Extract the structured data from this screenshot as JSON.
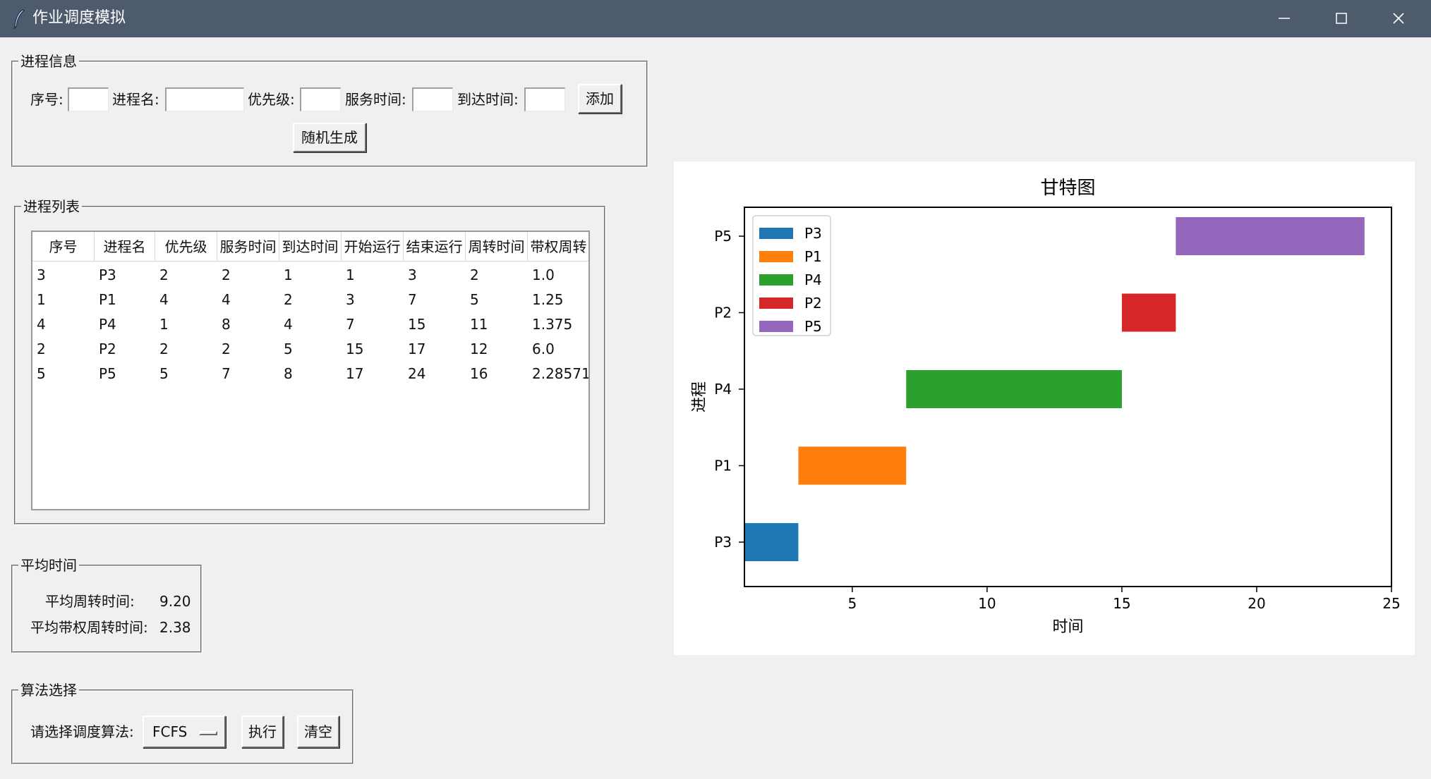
{
  "window": {
    "title": "作业调度模拟"
  },
  "process_info": {
    "group_title": "进程信息",
    "id_label": "序号:",
    "name_label": "进程名:",
    "priority_label": "优先级:",
    "service_label": "服务时间:",
    "arrival_label": "到达时间:",
    "id_value": "",
    "name_value": "",
    "priority_value": "",
    "service_value": "",
    "arrival_value": "",
    "add_button": "添加",
    "random_button": "随机生成"
  },
  "process_list": {
    "group_title": "进程列表",
    "columns": [
      "序号",
      "进程名",
      "优先级",
      "服务时间",
      "到达时间",
      "开始运行",
      "结束运行",
      "周转时间",
      "带权周转"
    ],
    "rows": [
      [
        "3",
        "P3",
        "2",
        "2",
        "1",
        "1",
        "3",
        "2",
        "1.0"
      ],
      [
        "1",
        "P1",
        "4",
        "4",
        "2",
        "3",
        "7",
        "5",
        "1.25"
      ],
      [
        "4",
        "P4",
        "1",
        "8",
        "4",
        "7",
        "15",
        "11",
        "1.375"
      ],
      [
        "2",
        "P2",
        "2",
        "2",
        "5",
        "15",
        "17",
        "12",
        "6.0"
      ],
      [
        "5",
        "P5",
        "5",
        "7",
        "8",
        "17",
        "24",
        "16",
        "2.2857142857142856"
      ]
    ]
  },
  "average": {
    "group_title": "平均时间",
    "turnaround_label": "平均周转时间:",
    "turnaround_value": "9.20",
    "weighted_label": "平均带权周转时间:",
    "weighted_value": "2.38"
  },
  "algorithm": {
    "group_title": "算法选择",
    "prompt": "请选择调度算法:",
    "selected": "FCFS",
    "run_button": "执行",
    "clear_button": "清空"
  },
  "chart_data": {
    "type": "gantt",
    "title": "甘特图",
    "xlabel": "时间",
    "ylabel": "进程",
    "xlim": [
      1,
      25
    ],
    "xticks": [
      5,
      10,
      15,
      20,
      25
    ],
    "categories": [
      "P3",
      "P1",
      "P4",
      "P2",
      "P5"
    ],
    "legend_position": "top-left",
    "series": [
      {
        "name": "P3",
        "start": 1,
        "end": 3,
        "color": "#1f77b4"
      },
      {
        "name": "P1",
        "start": 3,
        "end": 7,
        "color": "#ff7f0e"
      },
      {
        "name": "P4",
        "start": 7,
        "end": 15,
        "color": "#2ca02c"
      },
      {
        "name": "P2",
        "start": 15,
        "end": 17,
        "color": "#d62728"
      },
      {
        "name": "P5",
        "start": 17,
        "end": 24,
        "color": "#9467bd"
      }
    ]
  }
}
